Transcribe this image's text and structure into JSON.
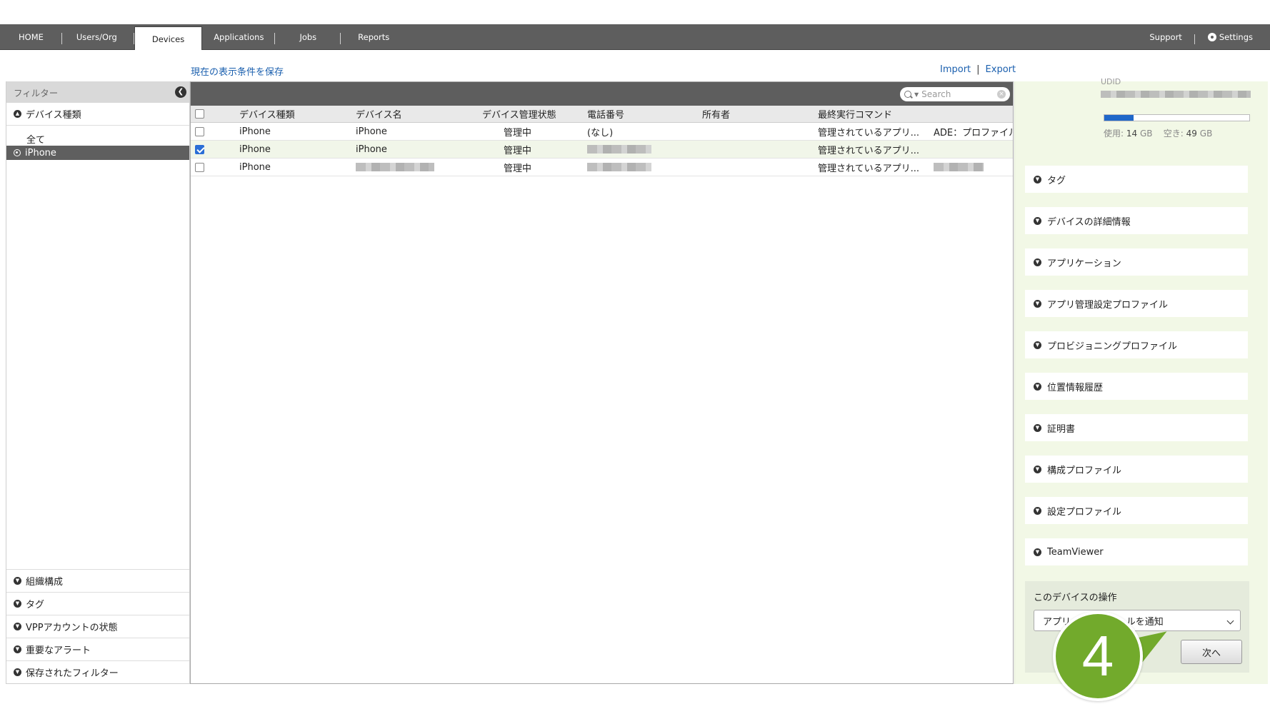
{
  "nav": {
    "tabs": [
      {
        "label": "HOME"
      },
      {
        "label": "Users/Org"
      },
      {
        "label": "Devices"
      },
      {
        "label": "Applications"
      },
      {
        "label": "Jobs"
      },
      {
        "label": "Reports"
      }
    ],
    "support": "Support",
    "settings": "Settings"
  },
  "toolbar": {
    "save_conditions": "現在の表示条件を保存",
    "import": "Import",
    "separator": "|",
    "export": "Export"
  },
  "filter": {
    "title": "フィルター",
    "device_type_section": "デバイス種類",
    "options": [
      "全て",
      "iPhone"
    ],
    "selected_option": "iPhone",
    "bottom_sections": [
      "組織構成",
      "タグ",
      "VPPアカウントの状態",
      "重要なアラート",
      "保存されたフィルター"
    ]
  },
  "search": {
    "placeholder": "Search"
  },
  "table": {
    "columns": [
      "デバイス種類",
      "デバイス名",
      "デバイス管理状態",
      "電話番号",
      "所有者",
      "最終実行コマンド"
    ],
    "rows": [
      {
        "type": "iPhone",
        "name": "iPhone",
        "status": "管理中",
        "phone": "(なし)",
        "owner": "",
        "last_command": "管理されているアプリ...",
        "extra": "ADE：プロファイル",
        "checked": false
      },
      {
        "type": "iPhone",
        "name": "iPhone",
        "status": "管理中",
        "phone": "",
        "owner": "",
        "last_command": "管理されているアプリ...",
        "extra": "",
        "checked": true
      },
      {
        "type": "iPhone",
        "name": "",
        "status": "管理中",
        "phone": "",
        "owner": "",
        "last_command": "管理されているアプリ...",
        "extra": "",
        "checked": false
      }
    ]
  },
  "detail": {
    "udid_label": "UDID",
    "storage": {
      "used_label": "使用:",
      "used_value": "14",
      "used_unit": "GB",
      "free_label": "空き:",
      "free_value": "49",
      "free_unit": "GB",
      "used_fraction": 0.2
    },
    "sections": [
      "タグ",
      "デバイスの詳細情報",
      "アプリケーション",
      "アプリ管理設定プロファイル",
      "プロビジョニングプロファイル",
      "位置情報履歴",
      "証明書",
      "構成プロファイル",
      "設定プロファイル",
      "TeamViewer"
    ],
    "operations": {
      "title": "このデバイスの操作",
      "selected": "アプリのインストールを通知",
      "next_button": "次へ"
    }
  },
  "step_marker": "4",
  "colors": {
    "nav_bg": "#5e5e5e",
    "link": "#1a5fae",
    "panel_bg": "#f2f8e6",
    "step_green": "#72aa2c",
    "checkbox_blue": "#2a6ed6"
  }
}
